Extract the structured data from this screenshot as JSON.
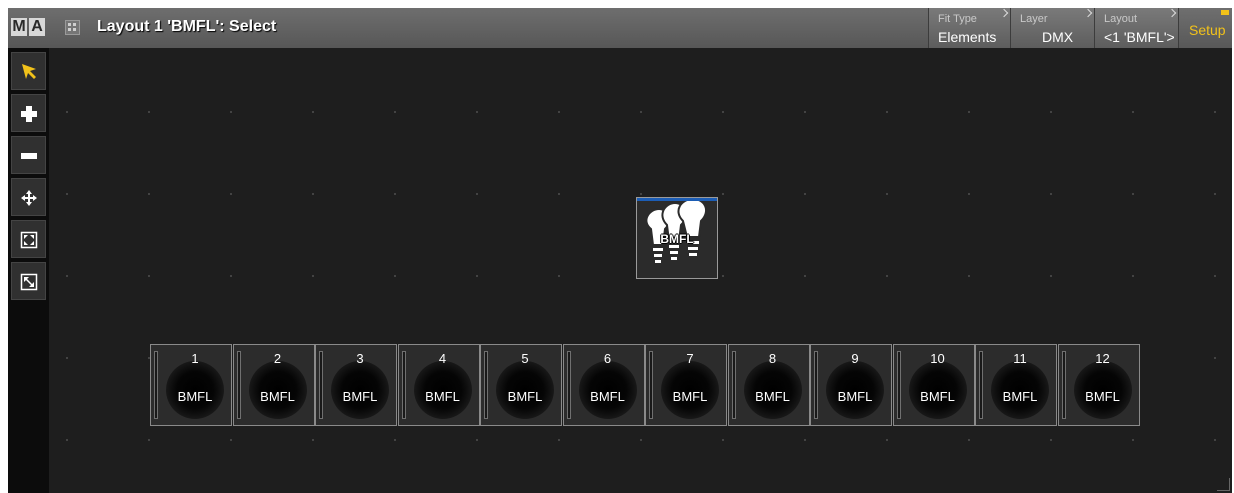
{
  "logo": {
    "m": "M",
    "a": "A"
  },
  "window": {
    "title": "Layout 1 'BMFL': Select"
  },
  "header_buttons": {
    "fit_type": {
      "label": "Fit Type",
      "value": "Elements"
    },
    "layer": {
      "label": "Layer",
      "value": "DMX"
    },
    "layout": {
      "label": "Layout",
      "value": "<1 'BMFL'>"
    },
    "setup": {
      "value": "Setup"
    }
  },
  "toolbar": {
    "tools": [
      {
        "name": "select-arrow-icon",
        "active": true
      },
      {
        "name": "add-plus-icon"
      },
      {
        "name": "remove-minus-icon"
      },
      {
        "name": "move-arrows-icon"
      },
      {
        "name": "fit-view-icon"
      },
      {
        "name": "zoom-extents-icon"
      }
    ]
  },
  "group": {
    "label": "BMFL",
    "icon": "bulbs-icon"
  },
  "fixtures": [
    {
      "id": "1",
      "name": "BMFL"
    },
    {
      "id": "2",
      "name": "BMFL"
    },
    {
      "id": "3",
      "name": "BMFL"
    },
    {
      "id": "4",
      "name": "BMFL"
    },
    {
      "id": "5",
      "name": "BMFL"
    },
    {
      "id": "6",
      "name": "BMFL"
    },
    {
      "id": "7",
      "name": "BMFL"
    },
    {
      "id": "8",
      "name": "BMFL"
    },
    {
      "id": "9",
      "name": "BMFL"
    },
    {
      "id": "10",
      "name": "BMFL"
    },
    {
      "id": "11",
      "name": "BMFL"
    },
    {
      "id": "12",
      "name": "BMFL"
    }
  ],
  "colors": {
    "accent": "#f2c21a",
    "selection": "#1c5db5",
    "background": "#1e1e1e"
  }
}
